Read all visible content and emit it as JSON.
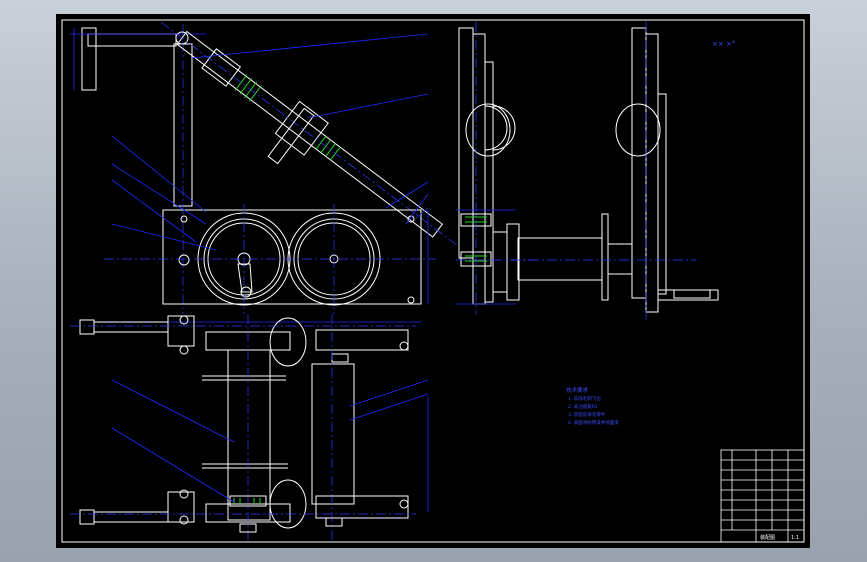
{
  "drawing": {
    "sheet_label": "×× ×°",
    "tech_notes": {
      "title": "技术要求",
      "items": [
        "1. 去除毛刺飞边",
        "2. 未注圆角R1",
        "3. 装配前清洗零件",
        "4. 表面涂防锈漆并喷面漆"
      ]
    },
    "title_block": {
      "drawing_name": "装配图",
      "sheet": "1:1"
    },
    "colors": {
      "outline": "#ffffff",
      "leader": "#1d2bff",
      "thread": "#22d622",
      "background": "#000000",
      "desktop": "#a7b0bc"
    }
  }
}
